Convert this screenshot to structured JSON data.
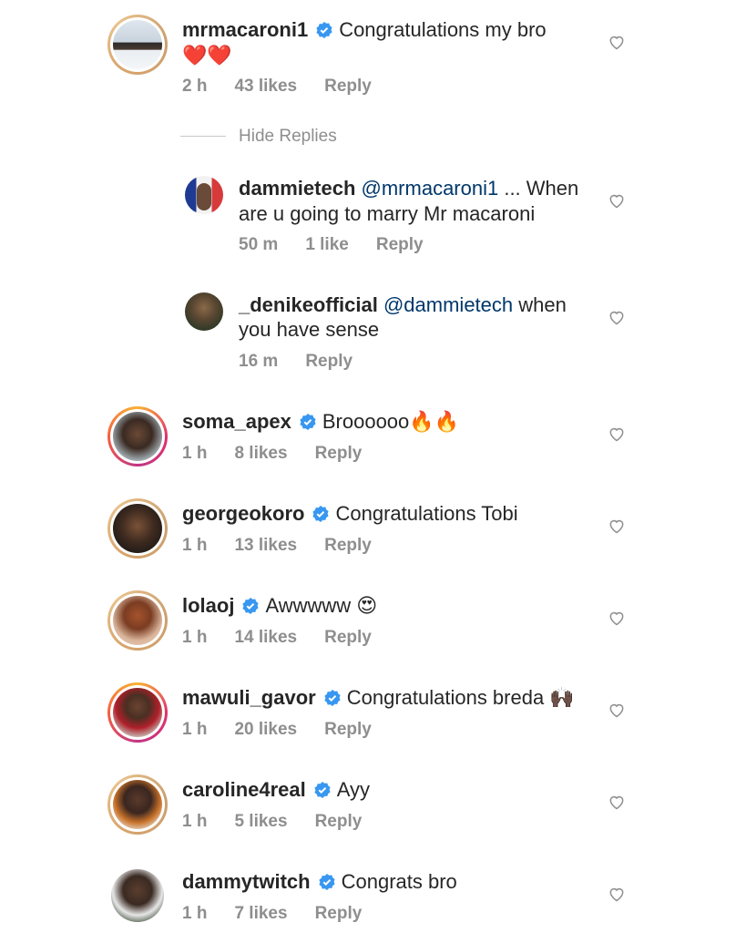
{
  "comments": [
    {
      "username": "mrmacaroni1",
      "verified": true,
      "text": "Congratulations my bro",
      "emoji": "❤️❤️",
      "time": "2 h",
      "likes": "43 likes",
      "reply": "Reply"
    },
    {
      "username": "dammietech",
      "verified": false,
      "mention": "@mrmacaroni1",
      "text": " ... When",
      "text2": "are u going to marry Mr macaroni",
      "time": "50 m",
      "likes": "1 like",
      "reply": "Reply"
    },
    {
      "username": "_denikeofficial",
      "verified": false,
      "mention": "@dammietech",
      "text": " when",
      "text2": "you have sense",
      "time": "16 m",
      "reply": "Reply"
    },
    {
      "username": "soma_apex",
      "verified": true,
      "text": "Broooooo",
      "emoji": "🔥🔥",
      "time": "1 h",
      "likes": "8 likes",
      "reply": "Reply"
    },
    {
      "username": "georgeokoro",
      "verified": true,
      "text": "Congratulations Tobi",
      "time": "1 h",
      "likes": "13 likes",
      "reply": "Reply"
    },
    {
      "username": "lolaoj",
      "verified": true,
      "text": "Awwwww",
      "emoji": "😍",
      "time": "1 h",
      "likes": "14 likes",
      "reply": "Reply"
    },
    {
      "username": "mawuli_gavor",
      "verified": true,
      "text": "Congratulations breda",
      "emoji": "🙌🏿",
      "time": "1 h",
      "likes": "20 likes",
      "reply": "Reply"
    },
    {
      "username": "caroline4real",
      "verified": true,
      "text": "Ayy",
      "time": "1 h",
      "likes": "5 likes",
      "reply": "Reply"
    },
    {
      "username": "dammytwitch",
      "verified": true,
      "text": "Congrats bro",
      "time": "1 h",
      "likes": "7 likes",
      "reply": "Reply"
    }
  ],
  "hide_replies": "Hide Replies",
  "colors": {
    "username": "#262626",
    "meta": "#8e8e8e",
    "mention": "#00376b",
    "verified": "#3897f0",
    "story_ring": "#d6a36b"
  }
}
